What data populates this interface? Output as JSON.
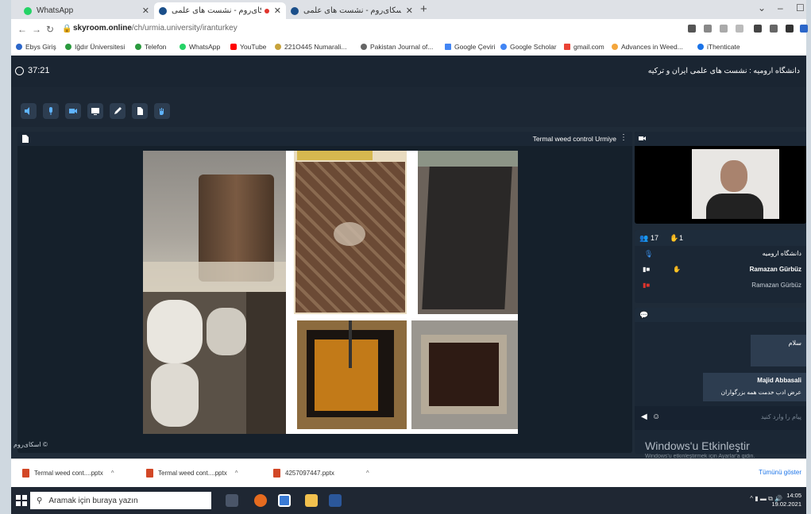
{
  "browser": {
    "tabs": [
      {
        "label": "WhatsApp",
        "favicon_color": "#25d366",
        "active": false
      },
      {
        "label": "اسکای‌روم - نشست های علمی",
        "favicon_color": "#1b4f8a",
        "active": true
      },
      {
        "label": "اسکای‌روم - نشست های علمی",
        "favicon_color": "#1b4f8a",
        "active": false
      }
    ],
    "url_host": "skyroom.online",
    "url_path": "/ch/urmia.university/iranturkey",
    "bookmarks": [
      {
        "label": "Ebys Giriş",
        "color": "#2b66c9"
      },
      {
        "label": "Iğdır Üniversitesi",
        "color": "#2b9a3e"
      },
      {
        "label": "Telefon",
        "color": "#2b9a3e"
      },
      {
        "label": "WhatsApp",
        "color": "#25d366"
      },
      {
        "label": "YouTube",
        "color": "#ff0000"
      },
      {
        "label": "221O445 Numarali...",
        "color": "#c7a33c"
      },
      {
        "label": "Pakistan Journal of...",
        "color": "#666666"
      },
      {
        "label": "Google Çeviri",
        "color": "#4285f4"
      },
      {
        "label": "Google Scholar",
        "color": "#4285f4"
      },
      {
        "label": "gmail.com",
        "color": "#ea4335"
      },
      {
        "label": "Advances in Weed...",
        "color": "#f4a63c"
      },
      {
        "label": "iThenticate",
        "color": "#1a73e8"
      }
    ]
  },
  "app": {
    "timer": "37:21",
    "room_title": "دانشگاه ارومیه : نشست های علمی ایران و ترکیه",
    "toolbar": [
      "speaker-icon",
      "microphone-icon",
      "camera-icon",
      "screen-share-icon",
      "pencil-icon",
      "file-icon",
      "hand-icon"
    ],
    "presentation_title": "Termal weed control Urmiye",
    "users": {
      "count": "17",
      "raised": "1",
      "list": [
        "دانشگاه ارومیه",
        "Ramazan Gürbüz",
        "Ramazan Gürbüz"
      ]
    },
    "chat": {
      "message1": "سلام",
      "sender2": "Majid Abbasali",
      "message2": "عرض ادب خدمت همه بزرگواران",
      "placeholder": "پیام را وارد کنید"
    },
    "footer": "اسکای‌روم ©"
  },
  "watermark": {
    "title": "Windows'u Etkinleştir",
    "subtitle": "Windows'u etkinleştirmek için Ayarlar'a gidin."
  },
  "downloads": [
    {
      "name": "Termal weed cont....pptx"
    },
    {
      "name": "Termal weed cont....pptx"
    },
    {
      "name": "4257097447.pptx"
    }
  ],
  "downloads_show_all": "Tümünü göster",
  "taskbar": {
    "search_placeholder": "Aramak için buraya yazın",
    "time": "14:05",
    "date": "19.02.2021"
  }
}
